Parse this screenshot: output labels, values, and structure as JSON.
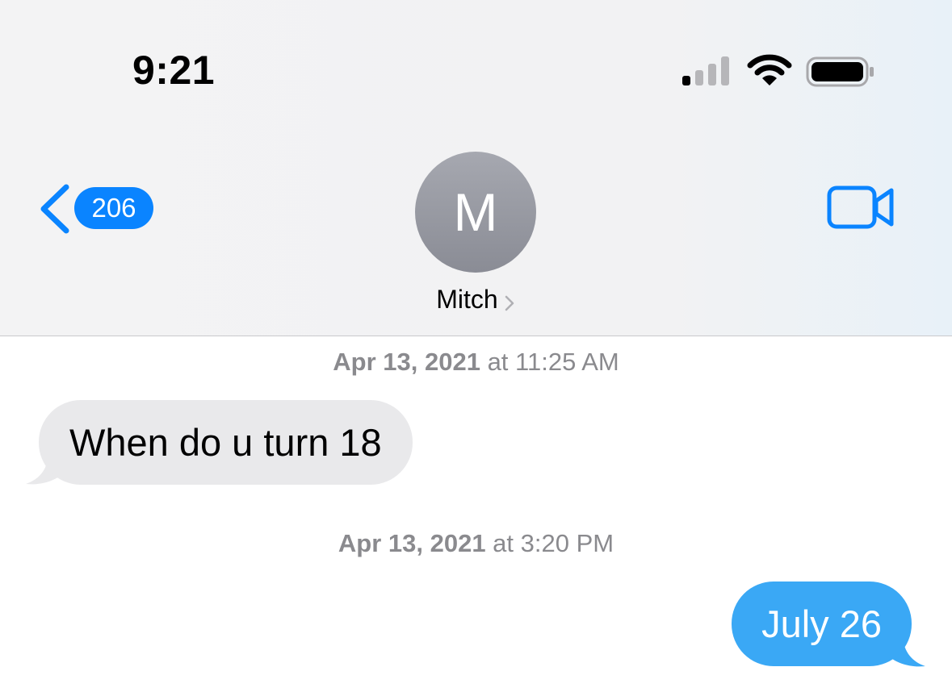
{
  "status_bar": {
    "time": "9:21",
    "icons": [
      "cellular-signal-icon",
      "wifi-icon",
      "battery-icon"
    ]
  },
  "nav": {
    "back_count": "206",
    "avatar_initial": "M",
    "contact_name": "Mitch",
    "icons": [
      "back-chevron-icon",
      "chevron-right-icon",
      "video-camera-icon"
    ]
  },
  "messages": [
    {
      "timestamp_date": "Apr 13, 2021",
      "timestamp_time": " at 11:25 AM",
      "direction": "incoming",
      "text": "When do u turn 18"
    },
    {
      "timestamp_date": "Apr 13, 2021",
      "timestamp_time": " at 3:20 PM",
      "direction": "outgoing",
      "text": "July 26"
    }
  ],
  "colors": {
    "accent_blue": "#0a84ff",
    "outgoing_bubble": "#3aa8f5",
    "incoming_bubble": "#e9e9eb",
    "timestamp_gray": "#8a8a8e",
    "avatar_gray": "#9a9ca4"
  }
}
